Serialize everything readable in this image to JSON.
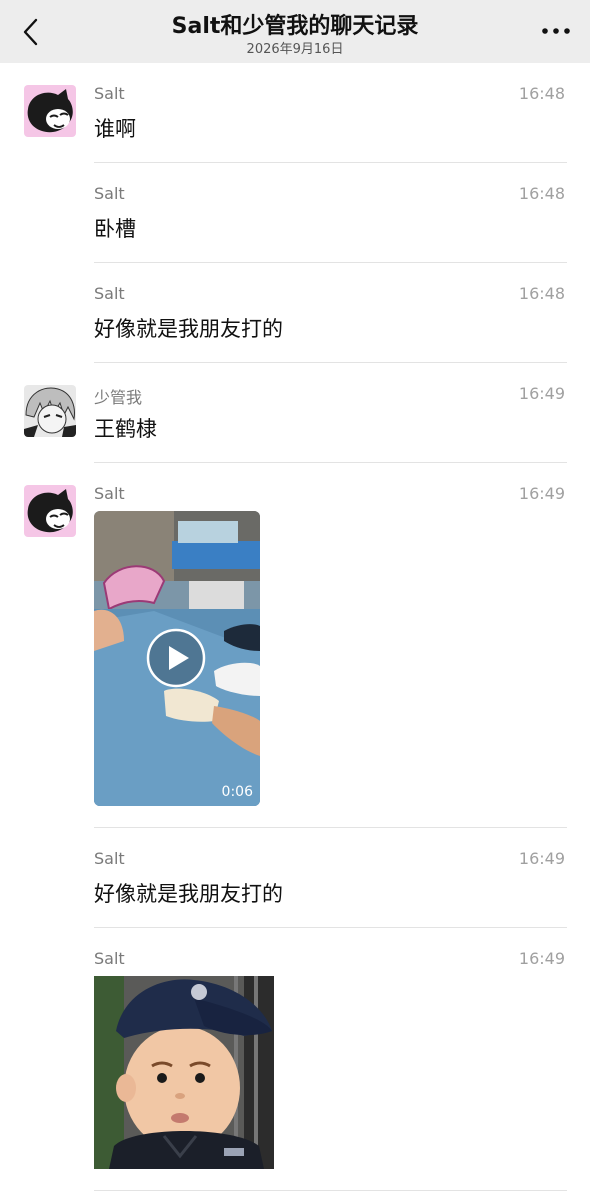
{
  "header": {
    "title": "Salt和少管我的聊天记录",
    "date": "2026年9月16日",
    "back_icon": "chevron-left-icon",
    "more_icon": "more-dots-icon"
  },
  "messages": [
    {
      "sender": "Salt",
      "time": "16:48",
      "text": "谁啊"
    },
    {
      "sender": "Salt",
      "time": "16:48",
      "text": "卧槽"
    },
    {
      "sender": "Salt",
      "time": "16:48",
      "text": "好像就是我朋友打的"
    },
    {
      "sender": "少管我",
      "time": "16:49",
      "text": "王鹤棣"
    },
    {
      "sender": "Salt",
      "time": "16:49",
      "video_duration": "0:06"
    },
    {
      "sender": "Salt",
      "time": "16:49",
      "text": "好像就是我朋友打的"
    },
    {
      "sender": "Salt",
      "time": "16:49",
      "sticker": "baby-police-cap-sticker"
    }
  ],
  "colors": {
    "header_bg": "#ededed",
    "divider": "#e3e3e3",
    "sender_text": "#7a7a7a",
    "time_text": "#a0a0a0",
    "salt_avatar_bg": "#f5c6e6"
  }
}
